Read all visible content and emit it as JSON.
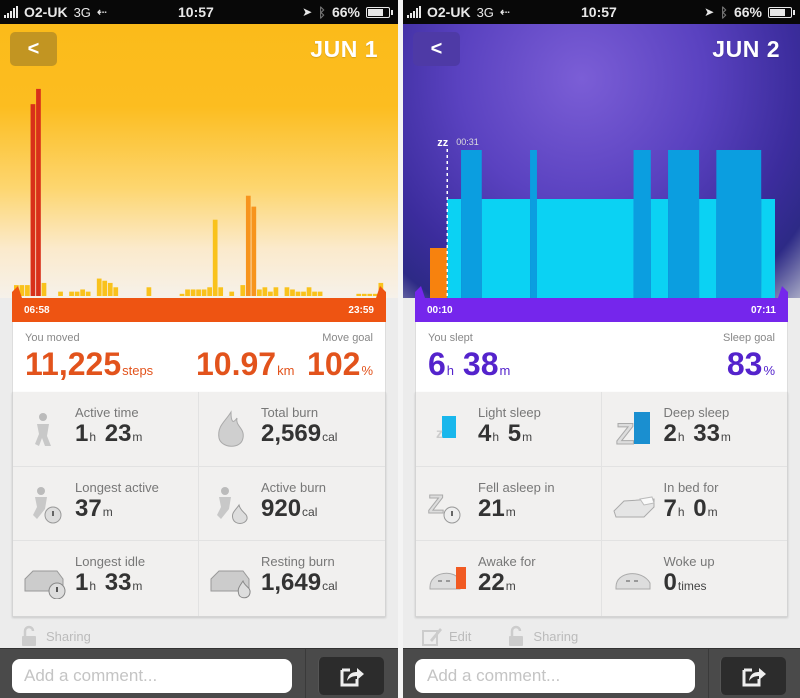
{
  "status_bar": {
    "carrier": "O2-UK",
    "network": "3G",
    "time": "10:57",
    "battery": "66%",
    "battery_level": 0.66
  },
  "activity_screen": {
    "title": "JUN 1",
    "back_label": "<",
    "colors": {
      "accent": "#e2531c",
      "timebar": "#ee5412",
      "bar_light": "#f9c21c",
      "bar_mid": "#f7941d",
      "bar_high": "#d8301a"
    },
    "timeline": {
      "start": "06:58",
      "end": "23:59"
    },
    "summary": {
      "moved_label": "You moved",
      "steps_value": "11,225",
      "steps_unit": "steps",
      "distance_value": "10.97",
      "distance_unit": "km",
      "goal_label": "Move goal",
      "goal_value": "102",
      "goal_unit": "%"
    },
    "stats": [
      {
        "icon": "running-person-icon",
        "label": "Active time",
        "value": [
          [
            "1",
            "h"
          ],
          [
            "23",
            "m"
          ]
        ]
      },
      {
        "icon": "flame-icon",
        "label": "Total burn",
        "value": [
          [
            "2,569",
            "cal"
          ]
        ]
      },
      {
        "icon": "running-stopwatch-icon",
        "label": "Longest active",
        "value": [
          [
            "37",
            "m"
          ]
        ]
      },
      {
        "icon": "running-flame-icon",
        "label": "Active burn",
        "value": [
          [
            "920",
            "cal"
          ]
        ]
      },
      {
        "icon": "couch-stopwatch-icon",
        "label": "Longest idle",
        "value": [
          [
            "1",
            "h"
          ],
          [
            "33",
            "m"
          ]
        ]
      },
      {
        "icon": "couch-flame-icon",
        "label": "Resting burn",
        "value": [
          [
            "1,649",
            "cal"
          ]
        ]
      }
    ],
    "actions": [
      {
        "icon": "lock-open-icon",
        "label": "Sharing"
      }
    ],
    "comment_placeholder": "Add a comment..."
  },
  "sleep_screen": {
    "title": "JUN 2",
    "back_label": "<",
    "colors": {
      "accent": "#5423cc",
      "timebar": "#7526ec",
      "light_sleep": "#0bd2f3",
      "deep_sleep": "#0b9ee0",
      "awake": "#f7820e"
    },
    "timeline": {
      "start": "00:10",
      "end": "07:11",
      "fell_asleep_marker": "00:31",
      "marker_icon": "zzz-icon"
    },
    "summary": {
      "slept_label": "You slept",
      "hours_value": "6",
      "hours_unit": "h",
      "minutes_value": "38",
      "minutes_unit": "m",
      "goal_label": "Sleep goal",
      "goal_value": "83",
      "goal_unit": "%"
    },
    "stats": [
      {
        "icon": "light-sleep-icon",
        "label": "Light sleep",
        "value": [
          [
            "4",
            "h"
          ],
          [
            "5",
            "m"
          ]
        ]
      },
      {
        "icon": "deep-sleep-icon",
        "label": "Deep sleep",
        "value": [
          [
            "2",
            "h"
          ],
          [
            "33",
            "m"
          ]
        ]
      },
      {
        "icon": "zzz-stopwatch-icon",
        "label": "Fell asleep in",
        "value": [
          [
            "21",
            "m"
          ]
        ]
      },
      {
        "icon": "bed-icon",
        "label": "In bed for",
        "value": [
          [
            "7",
            "h"
          ],
          [
            "0",
            "m"
          ]
        ]
      },
      {
        "icon": "awake-face-icon",
        "label": "Awake for",
        "value": [
          [
            "22",
            "m"
          ]
        ]
      },
      {
        "icon": "woke-face-icon",
        "label": "Woke up",
        "value": [
          [
            "0",
            "times"
          ]
        ]
      }
    ],
    "actions": [
      {
        "icon": "edit-icon",
        "label": "Edit"
      },
      {
        "icon": "lock-open-icon",
        "label": "Sharing"
      }
    ],
    "comment_placeholder": "Add a comment..."
  },
  "chart_data": [
    {
      "type": "bar",
      "title": "Activity JUN 1",
      "xlabel": "",
      "ylabel": "",
      "x_range": [
        "06:58",
        "23:59"
      ],
      "note": "relative activity intensity per time slot (0-1), estimated from bar heights",
      "values": [
        0.05,
        0.05,
        0.05,
        0.88,
        0.95,
        0.06,
        0.0,
        0.0,
        0.02,
        0.0,
        0.02,
        0.02,
        0.03,
        0.02,
        0.0,
        0.08,
        0.07,
        0.06,
        0.04,
        0.0,
        0.0,
        0.0,
        0.0,
        0.0,
        0.04,
        0.0,
        0.0,
        0.0,
        0.0,
        0.0,
        0.01,
        0.03,
        0.03,
        0.03,
        0.03,
        0.04,
        0.35,
        0.04,
        0.0,
        0.02,
        0.0,
        0.05,
        0.46,
        0.41,
        0.03,
        0.04,
        0.02,
        0.04,
        0.0,
        0.04,
        0.03,
        0.02,
        0.02,
        0.04,
        0.02,
        0.02,
        0.0,
        0.0,
        0.0,
        0.0,
        0.0,
        0.0,
        0.01,
        0.01,
        0.01,
        0.01,
        0.06
      ]
    },
    {
      "type": "bar",
      "title": "Sleep JUN 2",
      "xlabel": "",
      "ylabel": "",
      "x_range": [
        "00:10",
        "07:11"
      ],
      "note": "segments as fractions of timeline; level: awake=low, light=mid, deep=high",
      "segments": [
        {
          "state": "awake",
          "start": 0.0,
          "end": 0.05
        },
        {
          "state": "light",
          "start": 0.05,
          "end": 0.09
        },
        {
          "state": "deep",
          "start": 0.09,
          "end": 0.15
        },
        {
          "state": "light",
          "start": 0.15,
          "end": 0.29
        },
        {
          "state": "deep",
          "start": 0.29,
          "end": 0.31
        },
        {
          "state": "light",
          "start": 0.31,
          "end": 0.59
        },
        {
          "state": "deep",
          "start": 0.59,
          "end": 0.64
        },
        {
          "state": "light",
          "start": 0.64,
          "end": 0.69
        },
        {
          "state": "deep",
          "start": 0.69,
          "end": 0.78
        },
        {
          "state": "light",
          "start": 0.78,
          "end": 0.83
        },
        {
          "state": "deep",
          "start": 0.83,
          "end": 0.96
        },
        {
          "state": "light",
          "start": 0.96,
          "end": 1.0
        }
      ]
    }
  ]
}
